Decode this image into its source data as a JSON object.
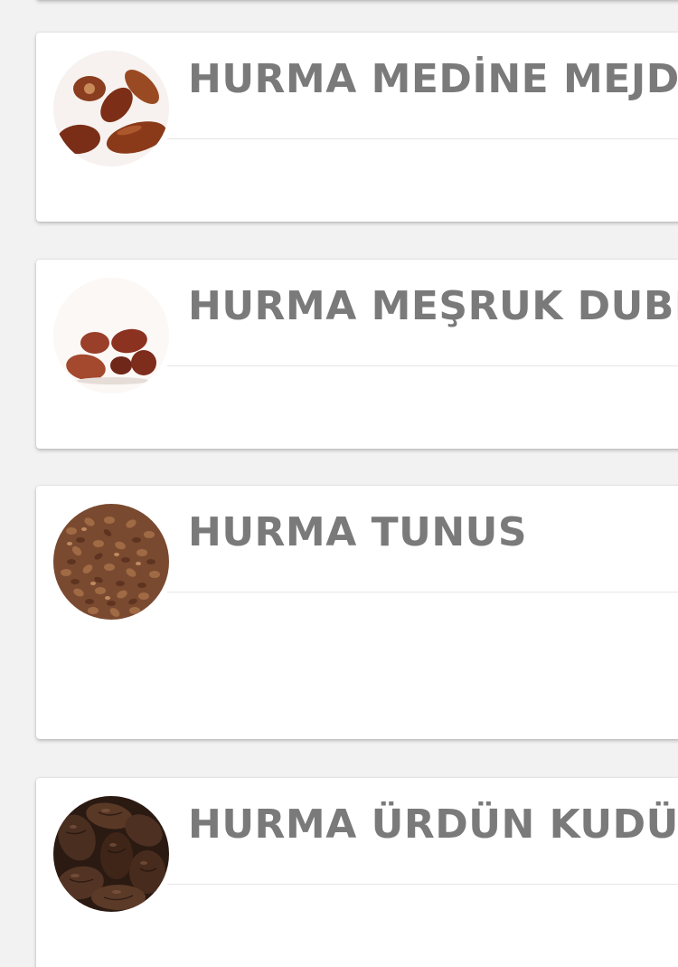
{
  "products": [
    {
      "title": "HURMA MEDİNE MEJDOUL",
      "image_icon": "medjool-dates-photo"
    },
    {
      "title": "HURMA MEŞRUK DUBLE",
      "image_icon": "mesruk-dates-photo"
    },
    {
      "title": "HURMA TUNUS",
      "image_icon": "tunisian-dates-photo"
    },
    {
      "title": "HURMA ÜRDÜN KUDÜS",
      "image_icon": "jordan-dates-photo"
    }
  ],
  "colors": {
    "background": "#f2f2f2",
    "card": "#ffffff",
    "title_text": "#7a7a7a",
    "divider": "#e6e6e6"
  }
}
